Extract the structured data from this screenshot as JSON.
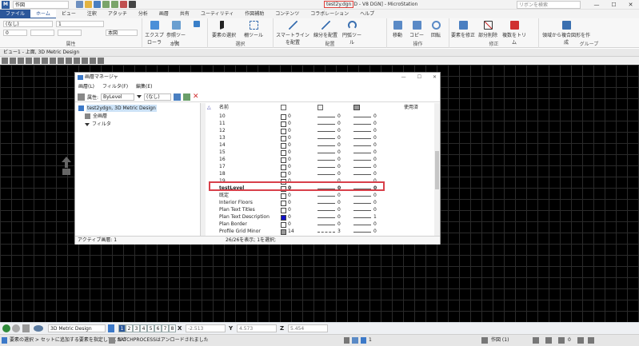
{
  "titlebar": {
    "workflow": "作図",
    "title_file": "test2y.dgn",
    "title_rest": "D - V8 DGN] - MicroStation",
    "search_placeholder": "リボンを検索",
    "min": "—",
    "max": "☐",
    "close": "✕"
  },
  "tabs": [
    "ファイル",
    "ホーム",
    "ビュー",
    "注釈",
    "アタッチ",
    "分析",
    "画層",
    "共有",
    "ユーティリティ",
    "作図補助",
    "コンテンツ",
    "コラボレーション",
    "ヘルプ"
  ],
  "ribbon": {
    "level_value": "(なし)",
    "num_value": "1",
    "style_value": "0",
    "level2_value": "本図",
    "groups": {
      "attributes": "属性",
      "primary": "本図",
      "selection": "選択",
      "placement": "配置",
      "manipulate": "操作",
      "modify": "修正",
      "groups": "グループ"
    },
    "buttons": {
      "explorer": "エクスプローラ",
      "reference": "参照ツール",
      "element_select": "要素の選択",
      "fence": "柵ツール",
      "smartline": "スマートラインを配置",
      "line_seg": "線分を配置",
      "arc_tool": "円弧ツール",
      "move": "移動",
      "copy": "コピー",
      "rotate": "回転",
      "modify_element": "要素を修正",
      "partial_delete": "部分削除",
      "trim": "複数をトリム",
      "region": "領域から複合図形を作成"
    }
  },
  "view": {
    "title": "ビュー1 - 上面, 3D Metric Design"
  },
  "dialog": {
    "title": "画層マネージャ",
    "menu": [
      "画層(L)",
      "フィルタ(F)",
      "編集(E)"
    ],
    "attr_label": "属性:",
    "attr_value": "ByLevel",
    "filter_value": "(なし)",
    "tree": [
      "test2ydgn, 3D Metric Design",
      "全画層",
      "フィルタ"
    ],
    "headers": {
      "name": "名前",
      "used": "使用済"
    },
    "rows": [
      {
        "name": "10",
        "color": "0",
        "style": "0",
        "weight": "0"
      },
      {
        "name": "11",
        "color": "0",
        "style": "0",
        "weight": "0"
      },
      {
        "name": "12",
        "color": "0",
        "style": "0",
        "weight": "0"
      },
      {
        "name": "13",
        "color": "0",
        "style": "0",
        "weight": "0"
      },
      {
        "name": "14",
        "color": "0",
        "style": "0",
        "weight": "0"
      },
      {
        "name": "15",
        "color": "0",
        "style": "0",
        "weight": "0"
      },
      {
        "name": "16",
        "color": "0",
        "style": "0",
        "weight": "0"
      },
      {
        "name": "17",
        "color": "0",
        "style": "0",
        "weight": "0"
      },
      {
        "name": "18",
        "color": "0",
        "style": "0",
        "weight": "0"
      },
      {
        "name": "19",
        "color": "0",
        "style": "0",
        "weight": "0"
      },
      {
        "name": "testLevel",
        "color": "0",
        "style": "0",
        "weight": "0"
      },
      {
        "name": "既定",
        "color": "0",
        "style": "0",
        "weight": "0"
      },
      {
        "name": "Interior Floors",
        "color": "0",
        "style": "0",
        "weight": "0"
      },
      {
        "name": "Plan Text Titles",
        "color": "0",
        "style": "0",
        "weight": "0"
      },
      {
        "name": "Plan Text Description",
        "color": "0",
        "style": "0",
        "weight": "1"
      },
      {
        "name": "Plan Border",
        "color": "0",
        "style": "0",
        "weight": "0"
      },
      {
        "name": "Profile Grid Minor",
        "color": "14",
        "style": "3",
        "weight": "0"
      }
    ],
    "status_left": "アクティブ画層: 1",
    "status_right": "26/26を表示; 1を選択;"
  },
  "bottombar": {
    "model": "3D Metric Design",
    "views": [
      "1",
      "2",
      "3",
      "4",
      "5",
      "6",
      "7",
      "8"
    ],
    "x_label": "X",
    "x_value": "-2.513",
    "y_label": "Y",
    "y_value": "4.573",
    "z_label": "Z",
    "z_value": "5.454"
  },
  "statusbar": {
    "prompt": "要素の選択 > セットに追加する要素を指定してくださ",
    "message": "BATCHPROCESSはアンロードされました",
    "level": "1",
    "workflow": "作図 (1)",
    "count": "0"
  },
  "colors": {
    "accent": "#2b579a",
    "highlight": "#d8404a",
    "selected_color_box": "#1010c8"
  }
}
